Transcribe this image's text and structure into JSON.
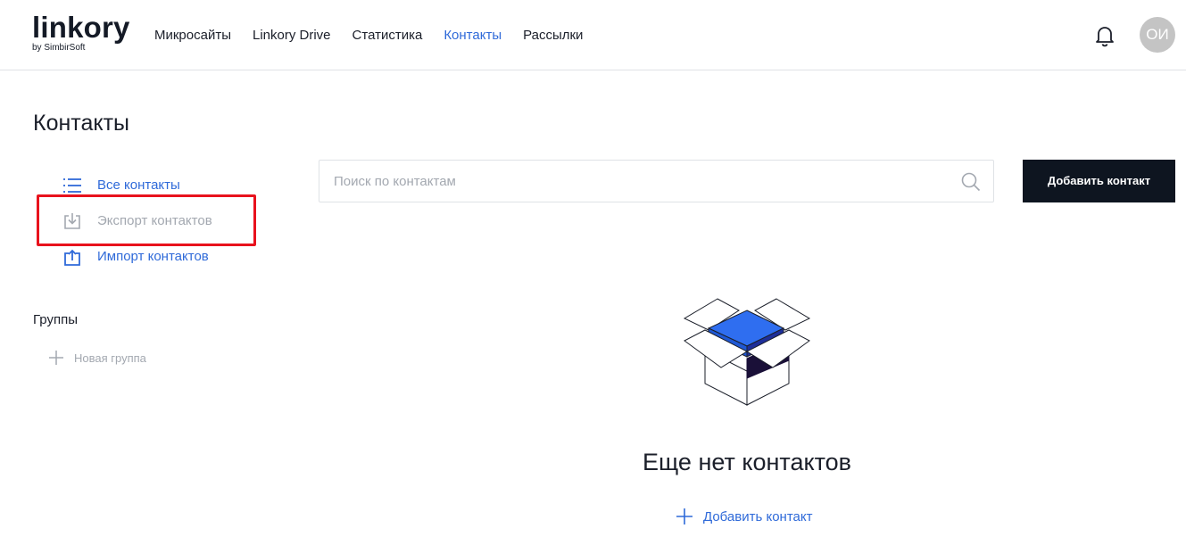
{
  "header": {
    "logo_main": "linkory",
    "logo_sub": "by SimbirSoft",
    "nav": [
      {
        "label": "Микросайты",
        "active": false
      },
      {
        "label": "Linkory Drive",
        "active": false
      },
      {
        "label": "Статистика",
        "active": false
      },
      {
        "label": "Контакты",
        "active": true
      },
      {
        "label": "Рассылки",
        "active": false
      }
    ],
    "avatar_initials": "ОИ"
  },
  "page": {
    "title": "Контакты"
  },
  "sidebar": {
    "items": [
      {
        "label": "Все контакты",
        "icon": "list-icon"
      },
      {
        "label": "Экспорт контактов",
        "icon": "download-icon"
      },
      {
        "label": "Импорт контактов",
        "icon": "upload-icon"
      }
    ],
    "groups_title": "Группы",
    "new_group_label": "Новая группа"
  },
  "search": {
    "placeholder": "Поиск по контактам",
    "value": ""
  },
  "toolbar": {
    "add_contact_label": "Добавить контакт"
  },
  "empty_state": {
    "title": "Еще нет контактов",
    "add_label": "Добавить контакт"
  },
  "colors": {
    "accent": "#2f6ad9",
    "dark_button": "#0e1520",
    "highlight": "#e8121d",
    "muted": "#a3a8b0",
    "box_blue": "#2f6ef0"
  }
}
